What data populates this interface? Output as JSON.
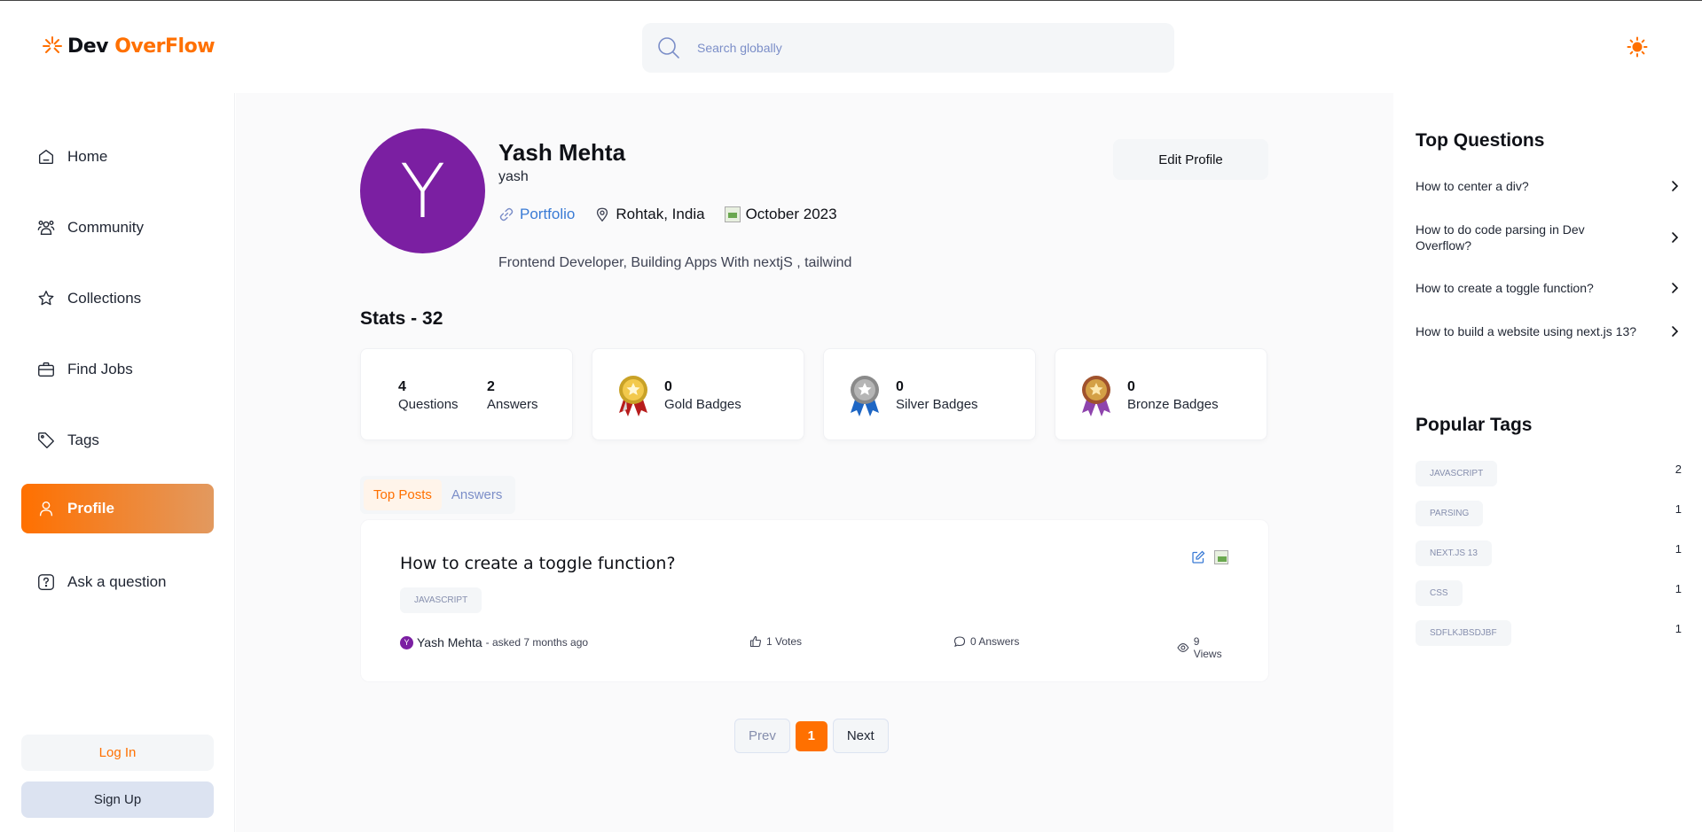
{
  "header": {
    "logo_part1": "Dev",
    "logo_part2": "OverFlow",
    "search_placeholder": "Search globally",
    "accent": "#ff7000"
  },
  "sidebar": {
    "items": [
      {
        "label": "Home",
        "icon": "home-icon"
      },
      {
        "label": "Community",
        "icon": "users-icon"
      },
      {
        "label": "Collections",
        "icon": "star-icon"
      },
      {
        "label": "Find Jobs",
        "icon": "suitcase-icon"
      },
      {
        "label": "Tags",
        "icon": "tag-icon"
      },
      {
        "label": "Profile",
        "icon": "user-icon",
        "active": true
      },
      {
        "label": "Ask a question",
        "icon": "question-icon"
      }
    ],
    "login_label": "Log In",
    "signup_label": "Sign Up"
  },
  "profile": {
    "avatar_letter": "Y",
    "avatar_color": "#7b1fa2",
    "name": "Yash Mehta",
    "username": "yash",
    "portfolio_label": "Portfolio",
    "location": "Rohtak, India",
    "joined": "October 2023",
    "bio": "Frontend Developer, Building Apps With nextjS , tailwind",
    "edit_label": "Edit Profile"
  },
  "stats": {
    "title": "Stats - 32",
    "questions": {
      "value": "4",
      "label": "Questions"
    },
    "answers": {
      "value": "2",
      "label": "Answers"
    },
    "gold": {
      "value": "0",
      "label": "Gold Badges"
    },
    "silver": {
      "value": "0",
      "label": "Silver Badges"
    },
    "bronze": {
      "value": "0",
      "label": "Bronze Badges"
    }
  },
  "tabs": [
    "Top Posts",
    "Answers"
  ],
  "post": {
    "title": "How to create a toggle function?",
    "tag": "JAVASCRIPT",
    "author": "Yash Mehta",
    "author_initial": "Y",
    "asked": "- asked 7 months ago",
    "votes": "1 Votes",
    "answers": "0 Answers",
    "views": "9 Views"
  },
  "pagination": {
    "prev": "Prev",
    "page": "1",
    "next": "Next"
  },
  "rightbar": {
    "top_questions_title": "Top Questions",
    "top_questions": [
      "How to center a div?",
      "How to do code parsing in Dev Overflow?",
      "How to create a toggle function?",
      "How to build a website using next.js 13?"
    ],
    "popular_tags_title": "Popular Tags",
    "popular_tags": [
      {
        "name": "JAVASCRIPT",
        "count": "2"
      },
      {
        "name": "PARSING",
        "count": "1"
      },
      {
        "name": "NEXT.JS 13",
        "count": "1"
      },
      {
        "name": "CSS",
        "count": "1"
      },
      {
        "name": "SDFLKJBSDJBF",
        "count": "1"
      }
    ]
  }
}
